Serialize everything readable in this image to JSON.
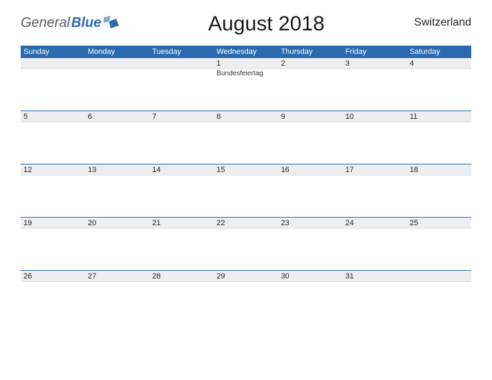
{
  "logo": {
    "part1": "General",
    "part2": "Blue"
  },
  "title": "August 2018",
  "country": "Switzerland",
  "weekdays": [
    "Sunday",
    "Monday",
    "Tuesday",
    "Wednesday",
    "Thursday",
    "Friday",
    "Saturday"
  ],
  "weeks": [
    [
      {
        "n": "",
        "e": ""
      },
      {
        "n": "",
        "e": ""
      },
      {
        "n": "",
        "e": ""
      },
      {
        "n": "1",
        "e": "Bundesfeiertag"
      },
      {
        "n": "2",
        "e": ""
      },
      {
        "n": "3",
        "e": ""
      },
      {
        "n": "4",
        "e": ""
      }
    ],
    [
      {
        "n": "5",
        "e": ""
      },
      {
        "n": "6",
        "e": ""
      },
      {
        "n": "7",
        "e": ""
      },
      {
        "n": "8",
        "e": ""
      },
      {
        "n": "9",
        "e": ""
      },
      {
        "n": "10",
        "e": ""
      },
      {
        "n": "11",
        "e": ""
      }
    ],
    [
      {
        "n": "12",
        "e": ""
      },
      {
        "n": "13",
        "e": ""
      },
      {
        "n": "14",
        "e": ""
      },
      {
        "n": "15",
        "e": ""
      },
      {
        "n": "16",
        "e": ""
      },
      {
        "n": "17",
        "e": ""
      },
      {
        "n": "18",
        "e": ""
      }
    ],
    [
      {
        "n": "19",
        "e": ""
      },
      {
        "n": "20",
        "e": ""
      },
      {
        "n": "21",
        "e": ""
      },
      {
        "n": "22",
        "e": ""
      },
      {
        "n": "23",
        "e": ""
      },
      {
        "n": "24",
        "e": ""
      },
      {
        "n": "25",
        "e": ""
      }
    ],
    [
      {
        "n": "26",
        "e": ""
      },
      {
        "n": "27",
        "e": ""
      },
      {
        "n": "28",
        "e": ""
      },
      {
        "n": "29",
        "e": ""
      },
      {
        "n": "30",
        "e": ""
      },
      {
        "n": "31",
        "e": ""
      },
      {
        "n": "",
        "e": ""
      }
    ]
  ]
}
